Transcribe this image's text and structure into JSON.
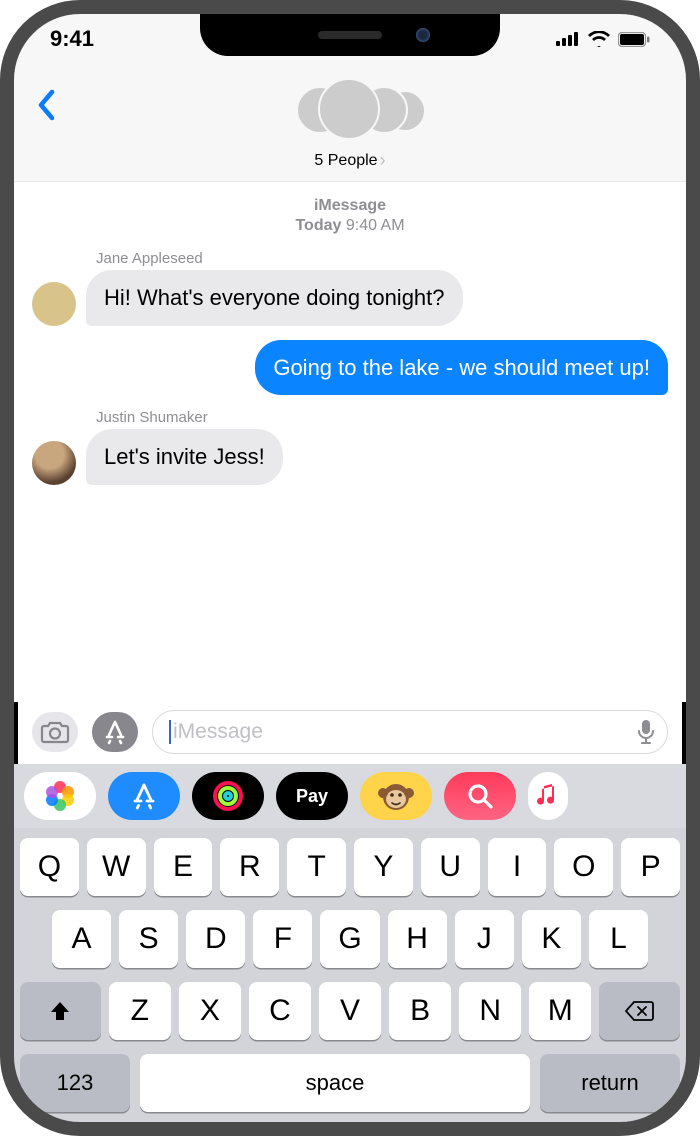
{
  "status": {
    "time": "9:41"
  },
  "header": {
    "participants_label": "5 People"
  },
  "thread": {
    "service": "iMessage",
    "date_label": "Today",
    "time_label": "9:40 AM",
    "messages": [
      {
        "sender": "Jane Appleseed",
        "text": "Hi! What's everyone doing tonight?",
        "direction": "received"
      },
      {
        "text": "Going to the lake - we should meet up!",
        "direction": "sent"
      },
      {
        "sender": "Justin Shumaker",
        "text": "Let's invite Jess!",
        "direction": "received"
      }
    ]
  },
  "compose": {
    "placeholder": "iMessage"
  },
  "app_strip": {
    "pay_label": "Pay"
  },
  "keyboard": {
    "row1": [
      "Q",
      "W",
      "E",
      "R",
      "T",
      "Y",
      "U",
      "I",
      "O",
      "P"
    ],
    "row2": [
      "A",
      "S",
      "D",
      "F",
      "G",
      "H",
      "J",
      "K",
      "L"
    ],
    "row3": [
      "Z",
      "X",
      "C",
      "V",
      "B",
      "N",
      "M"
    ],
    "numbers_label": "123",
    "space_label": "space",
    "return_label": "return"
  }
}
